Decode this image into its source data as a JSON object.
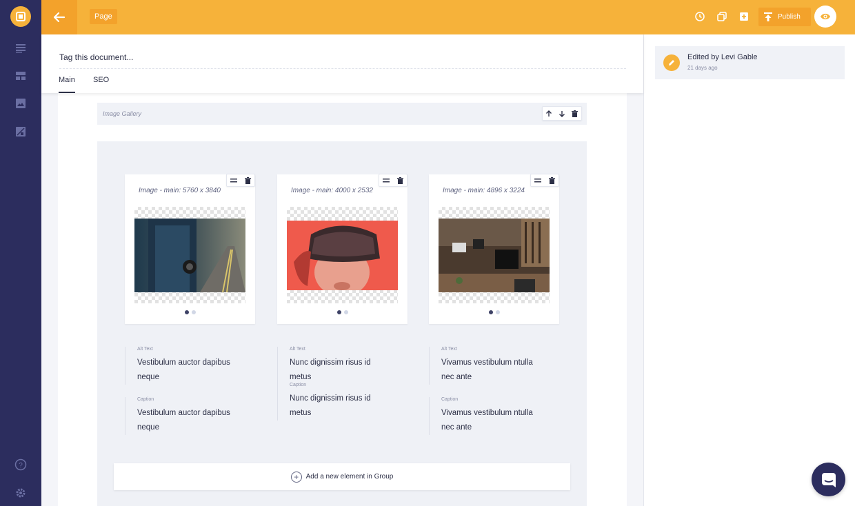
{
  "topbar": {
    "page_badge": "Page",
    "publish_label": "Publish"
  },
  "document": {
    "tag_placeholder": "Tag this document...",
    "tabs": [
      {
        "label": "Main",
        "active": true
      },
      {
        "label": "SEO",
        "active": false
      }
    ]
  },
  "gallery": {
    "label": "Image Gallery",
    "cards": [
      {
        "title": "Image - main: 5760 x 3840",
        "image": "person holding camera on road",
        "alt_label": "Alt Text",
        "alt_text": "Vestibulum auctor dapibus neque",
        "caption_label": "Caption",
        "caption": "Vestibulum auctor dapibus neque"
      },
      {
        "title": "Image - main: 4000 x 2532",
        "image": "person wearing VR headset on red background",
        "alt_label": "Alt Text",
        "alt_text": "Nunc dignissim risus id metus",
        "caption_label": "Caption",
        "caption": "Nunc dignissim risus id metus"
      },
      {
        "title": "Image - main: 4896 x 3224",
        "image": "open office interior",
        "alt_label": "Alt Text",
        "alt_text": "Vivamus vestibulum ntulla nec ante",
        "caption_label": "Caption",
        "caption": "Vivamus vestibulum ntulla nec ante"
      }
    ],
    "add_element_label": "Add a new element in Group"
  },
  "history": {
    "title": "Edited by Levi Gable",
    "time": "21 days ago"
  },
  "colors": {
    "accent": "#f6b23a",
    "accent_dark": "#f3a22b",
    "sidebar": "#2c2d5e",
    "text": "#2d3047"
  },
  "icons": {
    "sidebar": [
      "logo-icon",
      "list-icon",
      "layout-icon",
      "image-icon",
      "image-edit-icon",
      "help-icon",
      "settings-icon"
    ],
    "topbar": [
      "back-arrow-icon",
      "history-icon",
      "duplicate-icon",
      "add-box-icon",
      "publish-icon",
      "eye-icon"
    ]
  }
}
